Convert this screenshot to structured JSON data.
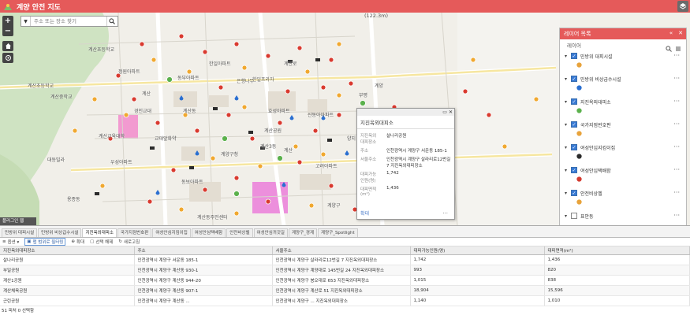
{
  "header": {
    "title": "계양 안전 지도"
  },
  "search": {
    "placeholder": "주소 또는 장소 찾기"
  },
  "map": {
    "coord_label": "(122.3m)",
    "minimap_label": "플러그인 웹",
    "labels": [
      "계산초등학교",
      "계산초등학교",
      "계산중학교",
      "계산교육대학",
      "교대앞화약",
      "계산동",
      "한일아파트",
      "정원아파트",
      "은행나무",
      "효성아파트",
      "동보아파트",
      "계양구청",
      "계산공원",
      "부평",
      "대동빌라",
      "경인교대",
      "동부아파트",
      "우성아파트",
      "계산로",
      "신동아아파트",
      "계양",
      "고려아파트",
      "한일프라자",
      "양지",
      "계산동주민센터",
      "용종동",
      "계산",
      "계양구",
      "계산",
      "계산3동"
    ]
  },
  "popup": {
    "title": "지진옥외대피소",
    "rows": [
      {
        "k": "지진옥외대피장소",
        "v": "살나리공원"
      },
      {
        "k": "주소",
        "v": "인천광역시 계양구 서운동 185-1"
      },
      {
        "k": "서울주소",
        "v": "인천광역시 계양구 살라리로12번길 7 지진옥외대피장소"
      },
      {
        "k": "대피가능인원(명)",
        "v": "1,742"
      },
      {
        "k": "대피면적(m²)",
        "v": "1,436"
      }
    ],
    "zoom_link": "확대",
    "more": "···"
  },
  "layer_panel": {
    "title": "레이어 목록",
    "subtitle": "레이어",
    "layers": [
      {
        "name": "민방위 대피시설",
        "checked": true,
        "color": "#e8a33b"
      },
      {
        "name": "민방위 비상급수시설",
        "checked": true,
        "color": "#2a6fd1"
      },
      {
        "name": "지진옥외대피소",
        "checked": true,
        "color": "#5bb14c"
      },
      {
        "name": "국가지점번호판",
        "checked": true,
        "color": "#e8a33b"
      },
      {
        "name": "여성안심지킴이집",
        "checked": true,
        "color": "#2b2b2b"
      },
      {
        "name": "여성안심택배함",
        "checked": true,
        "color": "#d43a2f"
      },
      {
        "name": "안전비상벨",
        "checked": true,
        "color": "#e8a33b"
      },
      {
        "name": "표안동",
        "checked": false,
        "color": "#999999"
      }
    ]
  },
  "bottom": {
    "tabs": [
      "민방위 대피시설",
      "민방위 비상급수시설",
      "지진옥외대피소",
      "국가지점번호판",
      "여성안심지킴이집",
      "여성안심택배함",
      "안전비상벨",
      "여성안심귀갓길",
      "계양구_경계",
      "계양구_Spotlight"
    ],
    "active_tab": 2,
    "toolbar": [
      "옵션 ▾",
      "맵 범위로 필터링",
      "확대",
      "선택 해제",
      "새로고침"
    ],
    "columns": [
      "지진옥외대피장소",
      "주소",
      "서울주소",
      "대피가능인원(명)",
      "대피면적(m²)"
    ],
    "rows": [
      [
        "살나리공원",
        "인천광역시 계양구 서운동 185-1",
        "인천광역시 계양구 살라리로12번길 7 지진옥외대피장소",
        "1,742",
        "1,436"
      ],
      [
        "부일공원",
        "인천광역시 계양구 계산동 930-1",
        "인천광역시 계양구 계양대로 145번길 24 지진옥외대피장소",
        "993",
        "820"
      ],
      [
        "계산1공원",
        "인천광역시 계양구 계산동 944-20",
        "인천광역시 계양구 봉오대로 653 지진옥외대피장소",
        "1,015",
        "838"
      ],
      [
        "계산체육공원",
        "인천광역시 계양구 계산동 907-1",
        "인천광역시 계양구 계산로 51 지진옥외대피장소",
        "18,904",
        "15,596"
      ],
      [
        "근린공원",
        "인천광역시 계양구 계산동 ...",
        "인천광역시 계양구 ... 지진옥외대피장소",
        "1,140",
        "1,010"
      ]
    ],
    "footer": "51 피처 0 선택함"
  },
  "colors": {
    "header": "#e55a5a",
    "accent": "#3a7bd5"
  }
}
